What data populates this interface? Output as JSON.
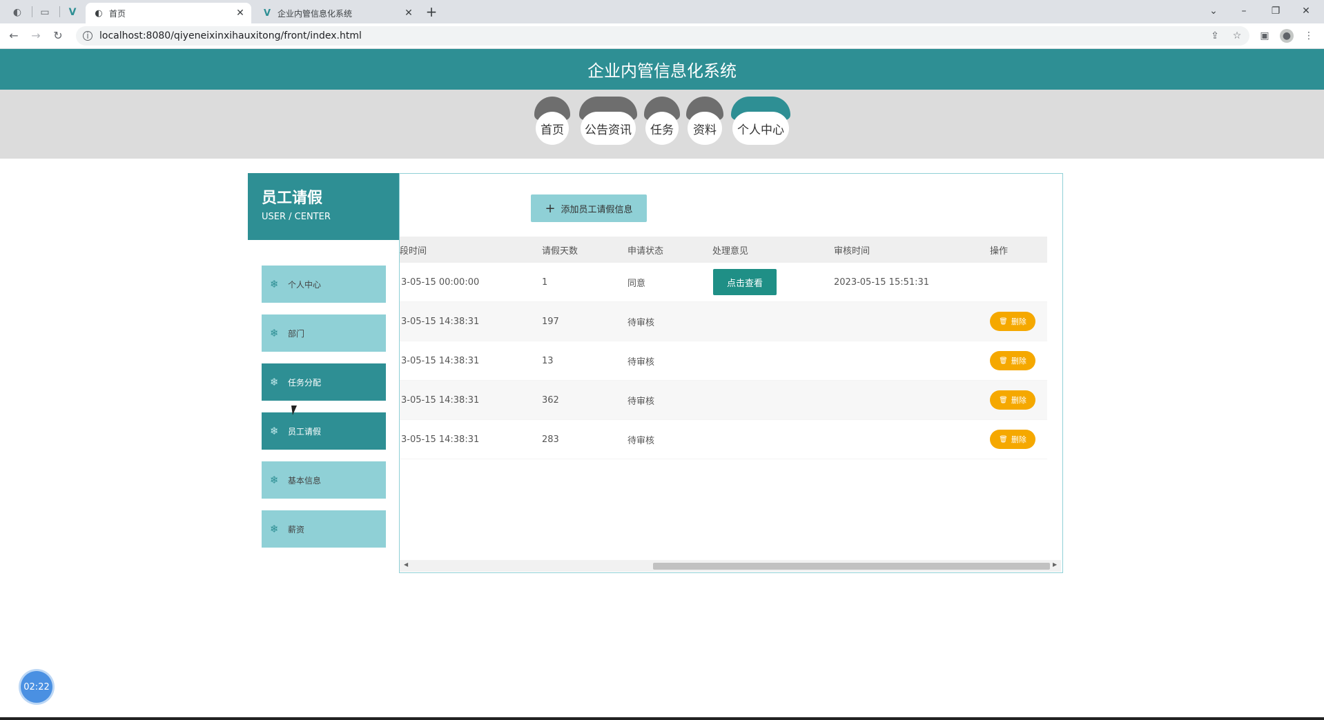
{
  "browser": {
    "tabs": [
      {
        "title": "首页",
        "active": true
      },
      {
        "title": "企业内管信息化系统",
        "active": false
      }
    ],
    "url": "localhost:8080/qiyeneixinxihauxitong/front/index.html"
  },
  "header": {
    "title": "企业内管信息化系统"
  },
  "nav": {
    "items": [
      {
        "label": "首页"
      },
      {
        "label": "公告资讯"
      },
      {
        "label": "任务"
      },
      {
        "label": "资料"
      },
      {
        "label": "个人中心",
        "active": true
      }
    ]
  },
  "sidebar": {
    "title": "员工请假",
    "subtitle": "USER / CENTER",
    "items": [
      {
        "label": "个人中心"
      },
      {
        "label": "部门"
      },
      {
        "label": "任务分配",
        "highlight": true
      },
      {
        "label": "员工请假",
        "highlight": true
      },
      {
        "label": "基本信息"
      },
      {
        "label": "薪资"
      }
    ]
  },
  "main": {
    "add_button": "添加员工请假信息",
    "columns": [
      "段时间",
      "请假天数",
      "申请状态",
      "处理意见",
      "审核时间",
      "操作"
    ],
    "rows": [
      {
        "time": "3-05-15 00:00:00",
        "days": "1",
        "status": "同意",
        "opinion": "点击查看",
        "audit_time": "2023-05-15 15:51:31",
        "action": ""
      },
      {
        "time": "3-05-15 14:38:31",
        "days": "197",
        "status": "待审核",
        "opinion": "",
        "audit_time": "",
        "action": "删除"
      },
      {
        "time": "3-05-15 14:38:31",
        "days": "13",
        "status": "待审核",
        "opinion": "",
        "audit_time": "",
        "action": "删除"
      },
      {
        "time": "3-05-15 14:38:31",
        "days": "362",
        "status": "待审核",
        "opinion": "",
        "audit_time": "",
        "action": "删除"
      },
      {
        "time": "3-05-15 14:38:31",
        "days": "283",
        "status": "待审核",
        "opinion": "",
        "audit_time": "",
        "action": "删除"
      }
    ]
  },
  "timer": "02:22",
  "colors": {
    "accent": "#2e8f94",
    "light_accent": "#8fd0d6",
    "delete": "#f5a800",
    "view": "#1f8f86"
  }
}
